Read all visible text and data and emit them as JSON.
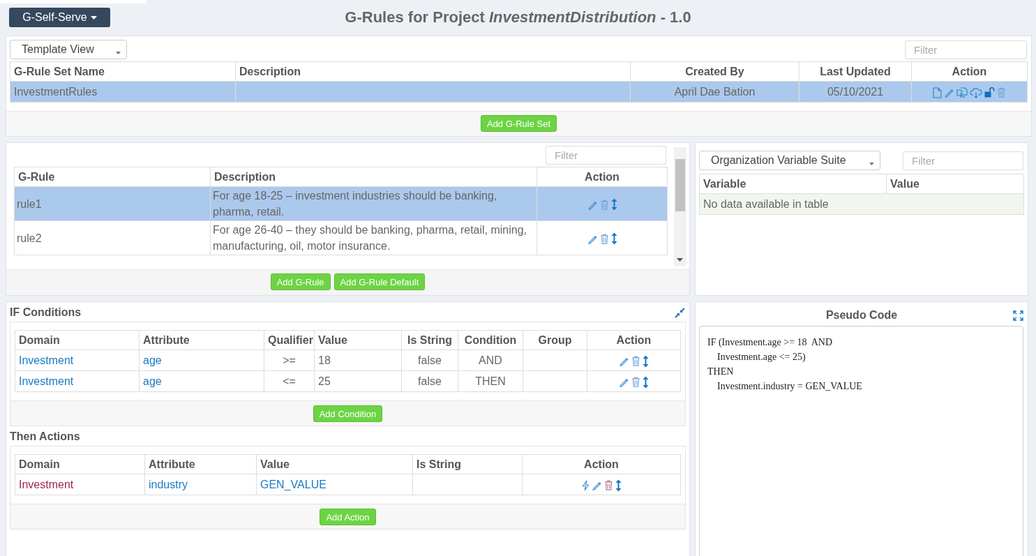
{
  "app_menu": {
    "label": "G-Self-Serve"
  },
  "page_title": "G-Rules for Project *InvestmentDistribution* - 1.0",
  "rule_sets": {
    "view_select": "Template View",
    "filter_placeholder": "Filter",
    "columns": [
      "G-Rule Set Name",
      "Description",
      "Created By",
      "Last Updated",
      "Action"
    ],
    "rows": [
      {
        "name": "InvestmentRules",
        "created_by": "April Dae Bation",
        "last_updated": "05/10/2021",
        "selected": true
      }
    ],
    "add_button": "Add G-Rule Set"
  },
  "rules": {
    "filter_placeholder": "Filter",
    "columns": [
      "G-Rule",
      "Description",
      "Action"
    ],
    "rows": [
      {
        "name": "rule1",
        "description": "For age 18-25 – investment industries should be banking, pharma, retail.",
        "selected": true
      },
      {
        "name": "rule2",
        "description": "For age 26-40 – they should be banking, pharma, retail, mining, manufacturing, oil, motor insurance.",
        "selected": false
      }
    ],
    "buttons": [
      "Add G-Rule",
      "Add G-Rule Default"
    ]
  },
  "variables": {
    "suite_select": "Organization Variable Suite",
    "filter_placeholder": "Filter",
    "columns": [
      "Variable",
      "Value"
    ],
    "empty_message": "No data available in table"
  },
  "if_conditions": {
    "title": "IF Conditions",
    "columns": [
      "Domain",
      "Attribute",
      "Qualifier",
      "Value",
      "Is String",
      "Condition",
      "Group",
      "Action"
    ],
    "rows": [
      {
        "domain": "Investment",
        "attribute": "age",
        "qualifier": ">=",
        "value": "18",
        "is_string": "false",
        "condition": "AND"
      },
      {
        "domain": "Investment",
        "attribute": "age",
        "qualifier": "<=",
        "value": "25",
        "is_string": "false",
        "condition": "THEN"
      }
    ],
    "add_button": "Add Condition"
  },
  "then_actions": {
    "title": "Then Actions",
    "columns": [
      "Domain",
      "Attribute",
      "Value",
      "Is String",
      "Action"
    ],
    "rows": [
      {
        "domain": "Investment",
        "attribute": "industry",
        "value": "GEN_VALUE"
      }
    ],
    "add_button": "Add Action"
  },
  "pseudo_code": {
    "title": "Pseudo Code",
    "lines": [
      "IF (Investment.age >= 18  AND",
      "    Investment.age <= 25)",
      "THEN",
      "    Investment.industry = GEN_VALUE"
    ]
  }
}
